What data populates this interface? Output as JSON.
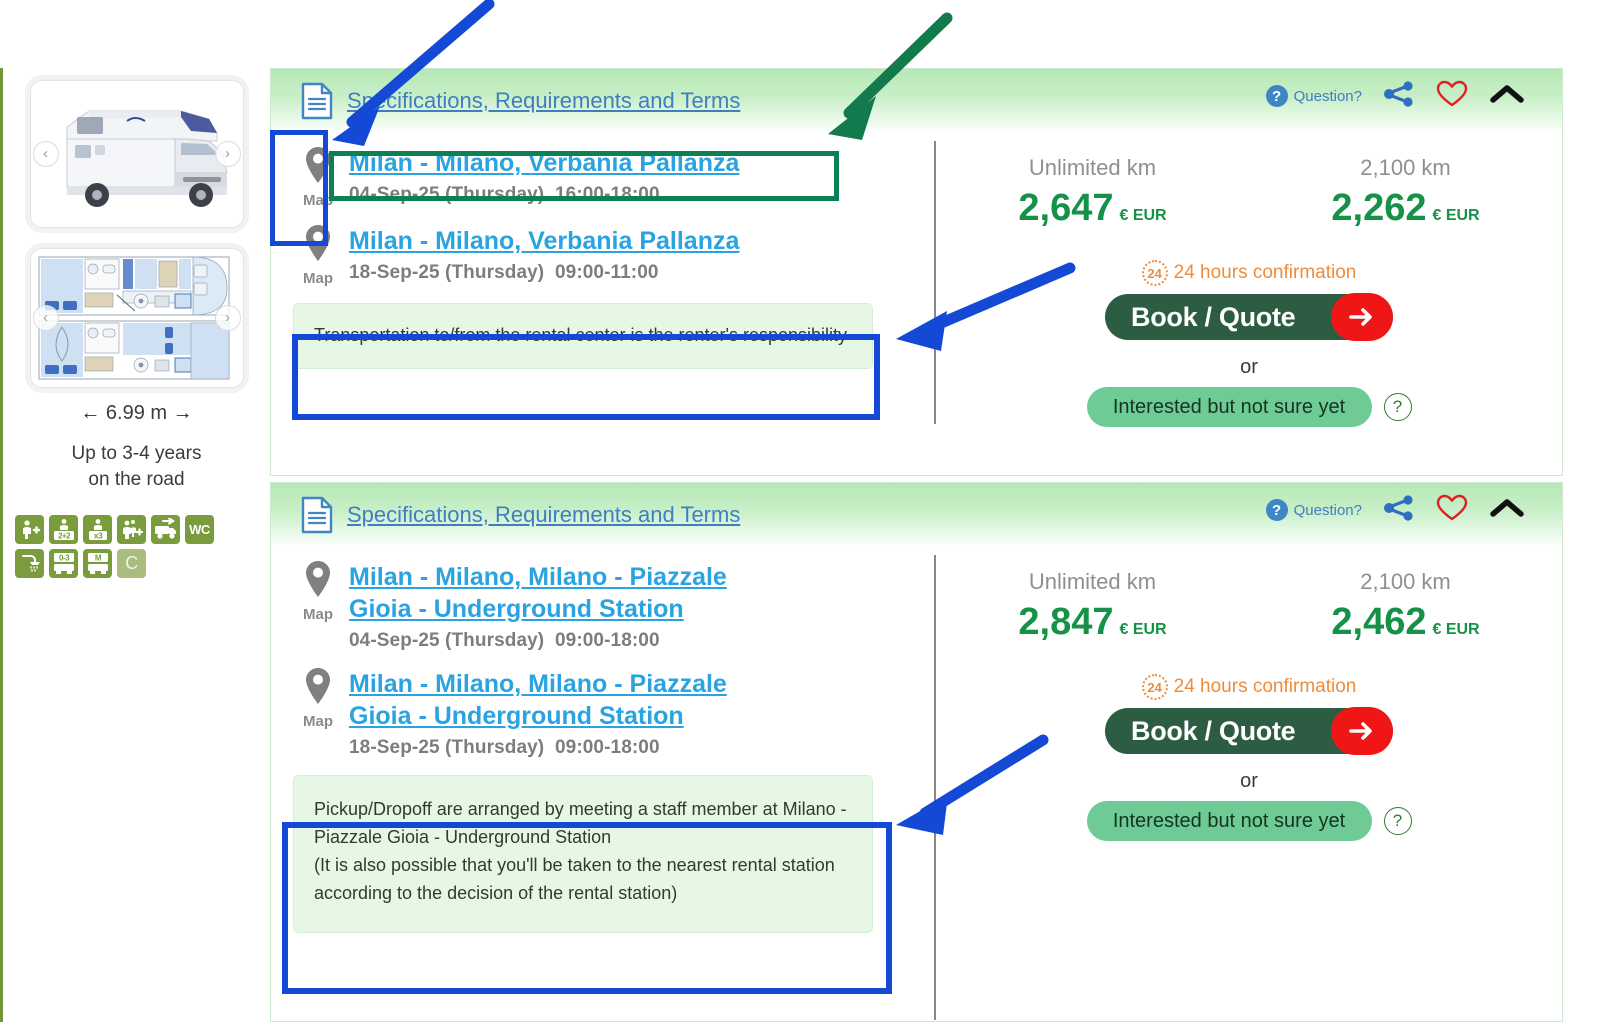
{
  "sidebar": {
    "prev_label": "‹",
    "next_label": "›",
    "dimension": "6.99 m",
    "dim_left_arrow": "←",
    "dim_right_arrow": "→",
    "age_line1": "Up to 3-4 years",
    "age_line2": "on the road",
    "feature_icons": [
      {
        "name": "child-seat-plus-icon",
        "text": "+"
      },
      {
        "name": "berths-2plus2-icon",
        "text": "2+2"
      },
      {
        "name": "seats-x3-icon",
        "text": "x3"
      },
      {
        "name": "family-plus-icon",
        "text": "+"
      },
      {
        "name": "transfer-vehicle-icon",
        "text": "→"
      },
      {
        "name": "wc-icon",
        "text": "WC"
      },
      {
        "name": "shower-icon",
        "text": ""
      },
      {
        "name": "age-0-3-icon",
        "text": "0-3"
      },
      {
        "name": "manual-transmission-icon",
        "text": "M"
      },
      {
        "name": "category-c-icon",
        "text": "C"
      }
    ]
  },
  "cards": [
    {
      "header": {
        "spec_link": "Specifications, Requirements and Terms",
        "question_label": "Question?",
        "question_badge": "?",
        "share_icon": "share-icon",
        "favorite_icon": "heart-icon",
        "collapse_icon": "chevron-up-icon"
      },
      "pickup": {
        "map_label": "Map",
        "location": "Milan - Milano, Verbania Pallanza",
        "date": "04-Sep-25 (Thursday)",
        "time": "16:00-18:00"
      },
      "dropoff": {
        "map_label": "Map",
        "location": "Milan - Milano, Verbania Pallanza",
        "date": "18-Sep-25 (Thursday)",
        "time": "09:00-11:00"
      },
      "note": "Transportation to/from the rental center is the renter's responsibility",
      "prices": [
        {
          "km_label": "Unlimited km",
          "amount": "2,647",
          "currency": "€ EUR"
        },
        {
          "km_label": "2,100 km",
          "amount": "2,262",
          "currency": "€ EUR"
        }
      ],
      "confirmation_badge": "24",
      "confirmation_text": "24 hours confirmation",
      "book_label": "Book / Quote",
      "or_label": "or",
      "interest_label": "Interested but not sure yet",
      "interest_help": "?"
    },
    {
      "header": {
        "spec_link": "Specifications, Requirements and Terms",
        "question_label": "Question?",
        "question_badge": "?",
        "share_icon": "share-icon",
        "favorite_icon": "heart-icon",
        "collapse_icon": "chevron-up-icon"
      },
      "pickup": {
        "map_label": "Map",
        "location_line1": "Milan - Milano, Milano - Piazzale",
        "location_line2": "Gioia - Underground Station",
        "date": "04-Sep-25 (Thursday)",
        "time": "09:00-18:00"
      },
      "dropoff": {
        "map_label": "Map",
        "location_line1": "Milan - Milano, Milano - Piazzale",
        "location_line2": "Gioia - Underground Station",
        "date": "18-Sep-25 (Thursday)",
        "time": "09:00-18:00"
      },
      "note_line1": "Pickup/Dropoff are arranged by meeting a staff member at Milano -",
      "note_line2": "Piazzale Gioia - Underground Station",
      "note_line3": "(It is also possible that you'll be taken to the nearest rental station",
      "note_line4": "according to the decision of the rental station)",
      "prices": [
        {
          "km_label": "Unlimited km",
          "amount": "2,847",
          "currency": "€ EUR"
        },
        {
          "km_label": "2,100 km",
          "amount": "2,462",
          "currency": "€ EUR"
        }
      ],
      "confirmation_badge": "24",
      "confirmation_text": "24 hours confirmation",
      "book_label": "Book / Quote",
      "or_label": "or",
      "interest_label": "Interested but not sure yet",
      "interest_help": "?"
    }
  ],
  "colors": {
    "accent_green": "#159247",
    "link_blue": "#2aa3e0",
    "spec_link_blue": "#3f7fc1",
    "book_green": "#2c5c42",
    "book_arrow_red": "#f01616",
    "interest_green": "#6ecb96",
    "orange": "#ef8c3a",
    "feature_icon_green": "#7a9c3c",
    "annotation_blue": "#1449d6",
    "annotation_green": "#127a4d",
    "header_green": "#b6e8b6"
  }
}
